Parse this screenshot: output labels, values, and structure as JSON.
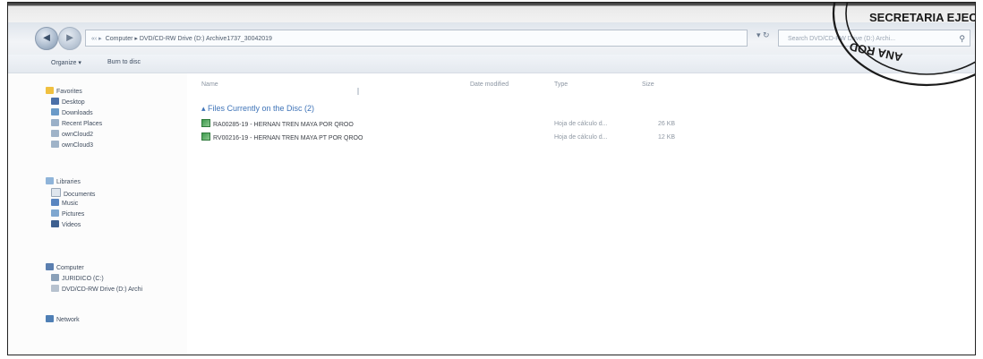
{
  "address": {
    "path": "Computer ▸ DVD/CD-RW Drive (D:) Archive1737_30042019",
    "prefix": "«‹ ▸"
  },
  "search": {
    "placeholder": "Search DVD/CD-RW Drive (D:) Archi..."
  },
  "toolbar": {
    "organize": "Organize ▾",
    "burn": "Burn to disc"
  },
  "nav": {
    "favorites": "Favorites",
    "favorites_items": [
      "Desktop",
      "Downloads",
      "Recent Places",
      "ownCloud2",
      "ownCloud3"
    ],
    "libraries": "Libraries",
    "libraries_items": [
      "Documents",
      "Music",
      "Pictures",
      "Videos"
    ],
    "computer": "Computer",
    "computer_items": [
      "JURIDICO (C:)",
      "DVD/CD-RW Drive (D:) Archi"
    ],
    "network": "Network"
  },
  "columns": {
    "name": "Name",
    "date": "Date modified",
    "type": "Type",
    "size": "Size"
  },
  "group_label": "▴ Files Currently on the Disc (2)",
  "files": [
    {
      "name": "RA00285-19 - HERNAN TREN MAYA POR QROO",
      "type": "Hoja de cálculo d...",
      "size": "26 KB"
    },
    {
      "name": "RV00216-19 - HERNAN TREN MAYA PT POR QROO",
      "type": "Hoja de cálculo d...",
      "size": "12 KB"
    }
  ],
  "stamp": {
    "line1": "SECRETARIA EJEC",
    "line2": "ANA ROD"
  },
  "colors": {
    "accent": "#3f74b8",
    "stamp": "#1a1a1a"
  }
}
